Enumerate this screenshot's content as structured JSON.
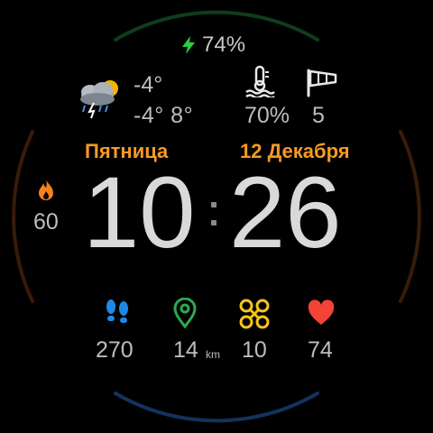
{
  "colors": {
    "background": "#000000",
    "accent_orange": "#f59a23",
    "battery_green": "#2ecc40",
    "steps_blue": "#1e88e5",
    "distance_green": "#2fa84f",
    "floors_yellow": "#f5c518",
    "heart_red": "#f44336",
    "text_gray": "#bdbdbd",
    "arc_top": "#0f3d1a",
    "arc_bottom": "#13335c",
    "arc_sides": "#3a1a08"
  },
  "battery": {
    "icon": "lightning-icon",
    "value": "74%"
  },
  "weather": {
    "icon": "storm-cloud-icon",
    "current_temp": "-4°",
    "range": "-4° 8°"
  },
  "humidity": {
    "icon": "thermometer-water-icon",
    "value": "70%"
  },
  "wind": {
    "icon": "windsock-icon",
    "value": "5"
  },
  "date": {
    "weekday": "Пятница",
    "date": "12 Декабря"
  },
  "calories": {
    "icon": "flame-icon",
    "value": "60"
  },
  "time": {
    "hours": "10",
    "minutes": "26"
  },
  "steps": {
    "icon": "footprints-icon",
    "value": "270"
  },
  "distance": {
    "icon": "location-pin-icon",
    "value": "14",
    "unit": "km"
  },
  "floors": {
    "icon": "floors-icon",
    "value": "10"
  },
  "heart": {
    "icon": "heart-icon",
    "value": "74"
  }
}
